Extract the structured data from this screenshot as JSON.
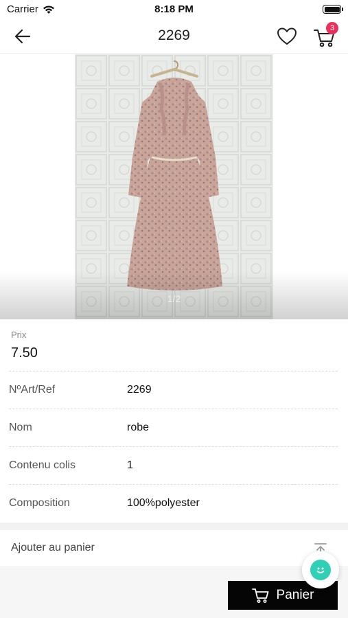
{
  "status_bar": {
    "carrier": "Carrier",
    "time": "8:18 PM"
  },
  "nav": {
    "title": "2269",
    "cart_count": "3"
  },
  "gallery": {
    "counter": "1/2"
  },
  "price": {
    "label": "Prix",
    "value": "7.50"
  },
  "details": [
    {
      "label": "NºArt/Ref",
      "value": "2269"
    },
    {
      "label": "Nom",
      "value": "robe"
    },
    {
      "label": "Contenu colis",
      "value": "1"
    },
    {
      "label": "Composition",
      "value": "100%polyester"
    }
  ],
  "actions": {
    "add_to_cart": "Ajouter au panier",
    "cart_button": "Panier"
  },
  "colors": {
    "badge": "#e8315b",
    "chat": "#2fd0b5",
    "button": "#050505"
  },
  "icons": [
    "back-arrow-icon",
    "heart-icon",
    "cart-icon",
    "scroll-top-icon",
    "chat-icon"
  ]
}
